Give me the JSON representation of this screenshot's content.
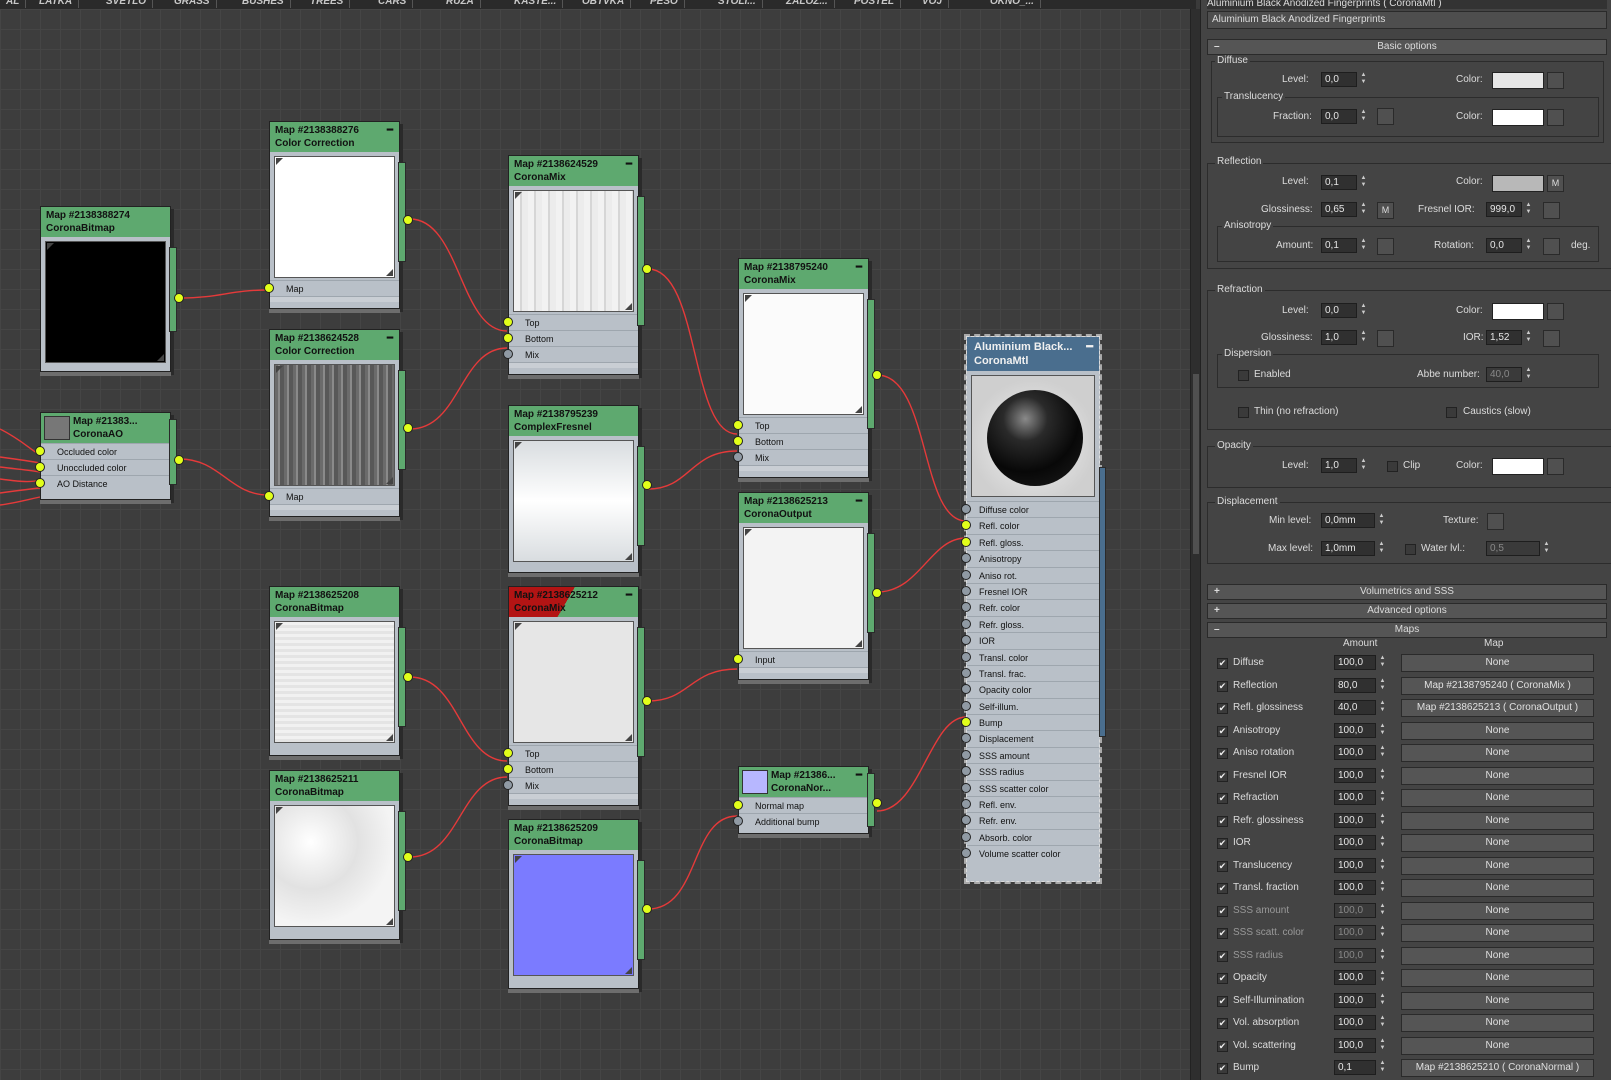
{
  "tabs": [
    "AL",
    "LATKA",
    "SVETLO",
    "GRASS",
    "BUSHES",
    "TREES",
    "CARS",
    "RUZA",
    "KASTE...",
    "OBTVKA",
    "PESO",
    "STOLI...",
    "ZALOZ...",
    "POSTEL",
    "VOJ",
    "OKNO_..."
  ],
  "nodes": {
    "n1": {
      "id": "Map #2138388274",
      "type": "CoronaBitmap"
    },
    "n2": {
      "id": "Map #21383...",
      "type": "CoronaAO",
      "slots": [
        "Occluded color",
        "Unoccluded color",
        "AO Distance"
      ]
    },
    "n3": {
      "id": "Map #2138388276",
      "type": "Color Correction",
      "slots": [
        "Map"
      ]
    },
    "n4": {
      "id": "Map #2138624528",
      "type": "Color Correction",
      "slots": [
        "Map"
      ]
    },
    "n5": {
      "id": "Map #2138624529",
      "type": "CoronaMix",
      "slots": [
        "Top",
        "Bottom",
        "Mix"
      ]
    },
    "n6": {
      "id": "Map #2138795239",
      "type": "ComplexFresnel"
    },
    "n7": {
      "id": "Map #2138795240",
      "type": "CoronaMix",
      "slots": [
        "Top",
        "Bottom",
        "Mix"
      ]
    },
    "n8": {
      "id": "Map #2138625213",
      "type": "CoronaOutput",
      "slots": [
        "Input"
      ]
    },
    "n9": {
      "id": "Map #2138625208",
      "type": "CoronaBitmap"
    },
    "n10": {
      "id": "Map #2138625211",
      "type": "CoronaBitmap"
    },
    "n11": {
      "id": "Map #2138625212",
      "type": "CoronaMix",
      "slots": [
        "Top",
        "Bottom",
        "Mix"
      ]
    },
    "n12": {
      "id": "Map #2138625209",
      "type": "CoronaBitmap"
    },
    "n13": {
      "id": "Map #21386...",
      "type": "CoronaNor...",
      "slots": [
        "Normal map",
        "Additional bump"
      ]
    }
  },
  "material": {
    "title": "Aluminium Black...",
    "type": "CoronaMtl",
    "slots": [
      "Diffuse color",
      "Refl. color",
      "Refl. gloss.",
      "Anisotropy",
      "Aniso rot.",
      "Fresnel IOR",
      "Refr. color",
      "Refr. gloss.",
      "IOR",
      "Transl. color",
      "Transl. frac.",
      "Opacity color",
      "Self-illum.",
      "Bump",
      "Displacement",
      "SSS amount",
      "SSS radius",
      "SSS scatter color",
      "Refl. env.",
      "Refr. env.",
      "Absorb. color",
      "Volume scatter color"
    ]
  },
  "panel": {
    "top_name": "Aluminium Black Anodized Fingerprints ( CoronaMtl )",
    "material_name": "Aluminium Black Anodized Fingerprints",
    "basic_options": "Basic options",
    "diffuse": {
      "title": "Diffuse",
      "level_label": "Level:",
      "level": "0,0",
      "color_label": "Color:"
    },
    "translucency": {
      "title": "Translucency",
      "fraction_label": "Fraction:",
      "fraction": "0,0",
      "color_label": "Color:"
    },
    "reflection": {
      "title": "Reflection",
      "level_label": "Level:",
      "level": "0,1",
      "color_label": "Color:",
      "m": "M",
      "gloss_label": "Glossiness:",
      "gloss": "0,65",
      "fresnel_label": "Fresnel IOR:",
      "fresnel": "999,0"
    },
    "anisotropy": {
      "title": "Anisotropy",
      "amount_label": "Amount:",
      "amount": "0,1",
      "rotation_label": "Rotation:",
      "rotation": "0,0",
      "unit": "deg."
    },
    "refraction": {
      "title": "Refraction",
      "level_label": "Level:",
      "level": "0,0",
      "color_label": "Color:",
      "gloss_label": "Glossiness:",
      "gloss": "1,0",
      "ior_label": "IOR:",
      "ior": "1,52"
    },
    "dispersion": {
      "title": "Dispersion",
      "enabled": "Enabled",
      "abbe_label": "Abbe number:",
      "abbe": "40,0"
    },
    "thin": "Thin (no refraction)",
    "caustics": "Caustics (slow)",
    "opacity": {
      "title": "Opacity",
      "level_label": "Level:",
      "level": "1,0",
      "clip": "Clip",
      "color_label": "Color:"
    },
    "displacement": {
      "title": "Displacement",
      "min_label": "Min level:",
      "min": "0,0mm",
      "texture_label": "Texture:",
      "max_label": "Max level:",
      "max": "1,0mm",
      "water_label": "Water lvl.:",
      "water": "0,5"
    },
    "volumetrics": "Volumetrics and SSS",
    "advanced": "Advanced options",
    "maps_title": "Maps",
    "col_amount": "Amount",
    "col_map": "Map",
    "maps": [
      {
        "name": "Diffuse",
        "amount": "100,0",
        "map": "None"
      },
      {
        "name": "Reflection",
        "amount": "80,0",
        "map": "Map #2138795240  ( CoronaMix )"
      },
      {
        "name": "Refl. glossiness",
        "amount": "40,0",
        "map": "Map #2138625213  ( CoronaOutput )"
      },
      {
        "name": "Anisotropy",
        "amount": "100,0",
        "map": "None"
      },
      {
        "name": "Aniso rotation",
        "amount": "100,0",
        "map": "None"
      },
      {
        "name": "Fresnel IOR",
        "amount": "100,0",
        "map": "None"
      },
      {
        "name": "Refraction",
        "amount": "100,0",
        "map": "None"
      },
      {
        "name": "Refr. glossiness",
        "amount": "100,0",
        "map": "None"
      },
      {
        "name": "IOR",
        "amount": "100,0",
        "map": "None"
      },
      {
        "name": "Translucency",
        "amount": "100,0",
        "map": "None"
      },
      {
        "name": "Transl. fraction",
        "amount": "100,0",
        "map": "None"
      },
      {
        "name": "SSS amount",
        "amount": "100,0",
        "map": "None"
      },
      {
        "name": "SSS scatt. color",
        "amount": "100,0",
        "map": "None"
      },
      {
        "name": "SSS radius",
        "amount": "100,0",
        "map": "None"
      },
      {
        "name": "Opacity",
        "amount": "100,0",
        "map": "None"
      },
      {
        "name": "Self-Illumination",
        "amount": "100,0",
        "map": "None"
      },
      {
        "name": "Vol. absorption",
        "amount": "100,0",
        "map": "None"
      },
      {
        "name": "Vol. scattering",
        "amount": "100,0",
        "map": "None"
      },
      {
        "name": "Bump",
        "amount": "0,1",
        "map": "Map #2138625210  ( CoronaNormal )"
      }
    ]
  },
  "colors": {
    "node_header": "#5ea96f",
    "material_header": "#4a6e8e",
    "wire": "#e53a3a",
    "port_active": "#e2ff1a",
    "normal_map": "#7b7bff"
  }
}
